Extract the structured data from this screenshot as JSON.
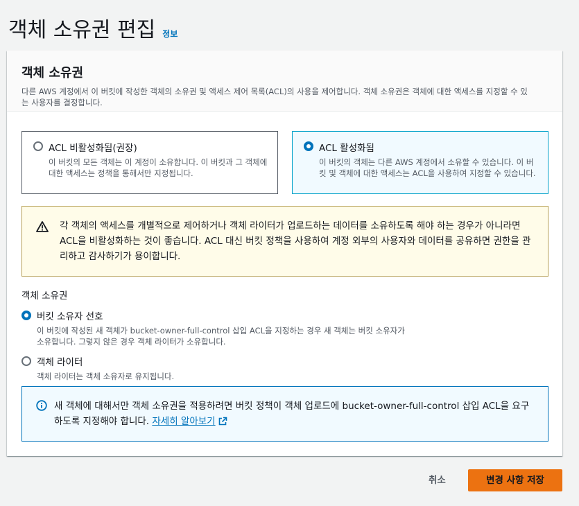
{
  "header": {
    "title": "객체 소유권 편집",
    "info_link": "정보"
  },
  "panel": {
    "title": "객체 소유권",
    "description": "다른 AWS 계정에서 이 버킷에 작성한 객체의 소유권 및 액세스 제어 목록(ACL)의 사용을 제어합니다. 객체 소유권은 객체에 대한 액세스를 지정할 수 있는 사용자를 결정합니다."
  },
  "acl_tiles": [
    {
      "label": "ACL 비활성화됨(권장)",
      "description": "이 버킷의 모든 객체는 이 계정이 소유합니다. 이 버킷과 그 객체에 대한 액세스는 정책을 통해서만 지정됩니다.",
      "selected": false
    },
    {
      "label": "ACL 활성화됨",
      "description": "이 버킷의 객체는 다른 AWS 계정에서 소유할 수 있습니다. 이 버킷 및 객체에 대한 액세스는 ACL을 사용하여 지정할 수 있습니다.",
      "selected": true
    }
  ],
  "warning": {
    "text": "각 객체의 액세스를 개별적으로 제어하거나 객체 라이터가 업로드하는 데이터를 소유하도록 해야 하는 경우가 아니라면 ACL을 비활성화하는 것이 좋습니다. ACL 대신 버킷 정책을 사용하여 계정 외부의 사용자와 데이터를 공유하면 권한을 관리하고 감사하기가 용이합니다."
  },
  "ownership": {
    "label": "객체 소유권",
    "options": [
      {
        "label": "버킷 소유자 선호",
        "description": "이 버킷에 작성된 새 객체가 bucket-owner-full-control 삽입 ACL을 지정하는 경우 새 객체는 버킷 소유자가 소유합니다. 그렇지 않은 경우 객체 라이터가 소유합니다.",
        "selected": true
      },
      {
        "label": "객체 라이터",
        "description": "객체 라이터는 객체 소유자로 유지됩니다.",
        "selected": false
      }
    ]
  },
  "info": {
    "text": "새 객체에 대해서만 객체 소유권을 적용하려면 버킷 정책이 객체 업로드에 bucket-owner-full-control 삽입 ACL을 요구하도록 지정해야 합니다. ",
    "link": "자세히 알아보기"
  },
  "footer": {
    "cancel_label": "취소",
    "save_label": "변경 사항 저장"
  },
  "colors": {
    "accent": "#0073bb",
    "primary_button": "#ec7211",
    "warning_border": "#b7a057",
    "warning_bg": "#fffce9",
    "info_bg": "#f1faff"
  },
  "icons": [
    "warning-icon",
    "info-icon",
    "external-link-icon"
  ]
}
